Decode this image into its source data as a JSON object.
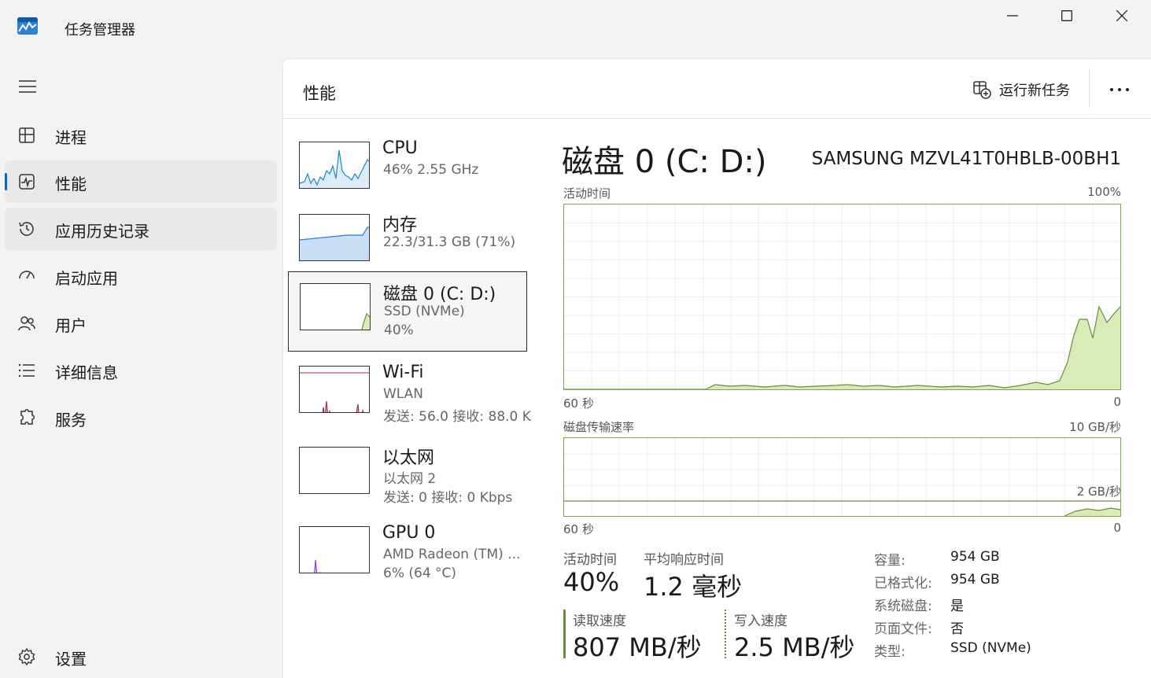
{
  "app": {
    "title": "任务管理器"
  },
  "nav": {
    "items": [
      {
        "label": "进程",
        "icon": "processes-icon"
      },
      {
        "label": "性能",
        "icon": "performance-icon"
      },
      {
        "label": "应用历史记录",
        "icon": "history-icon"
      },
      {
        "label": "启动应用",
        "icon": "startup-icon"
      },
      {
        "label": "用户",
        "icon": "users-icon"
      },
      {
        "label": "详细信息",
        "icon": "details-icon"
      },
      {
        "label": "服务",
        "icon": "services-icon"
      }
    ],
    "settings_label": "设置"
  },
  "header": {
    "title": "性能",
    "run_task_label": "运行新任务",
    "more_label": "···"
  },
  "devices": [
    {
      "name": "CPU",
      "sub1": "46%  2.55 GHz",
      "sub2": ""
    },
    {
      "name": "内存",
      "sub1": "22.3/31.3 GB (71%)",
      "sub2": ""
    },
    {
      "name": "磁盘 0 (C: D:)",
      "sub1": "SSD (NVMe)",
      "sub2": "40%"
    },
    {
      "name": "Wi-Fi",
      "sub1": "WLAN",
      "sub2": "发送: 56.0  接收: 88.0 K"
    },
    {
      "name": "以太网",
      "sub1": "以太网 2",
      "sub2": "发送: 0  接收: 0 Kbps"
    },
    {
      "name": "GPU 0",
      "sub1": "AMD Radeon (TM) ...",
      "sub2": "6%  (64 °C)"
    }
  ],
  "detail": {
    "title": "磁盘 0 (C: D:)",
    "model": "SAMSUNG MZVL41T0HBLB-00BH1",
    "graph1": {
      "label": "活动时间",
      "max": "100%",
      "time": "60 秒",
      "min": "0"
    },
    "graph2": {
      "label": "磁盘传输速率",
      "max": "10 GB/秒",
      "mid": "2 GB/秒",
      "time": "60 秒",
      "min": "0"
    },
    "stats": {
      "active_label": "活动时间",
      "active_value": "40%",
      "resp_label": "平均响应时间",
      "resp_value": "1.2 毫秒",
      "read_label": "读取速度",
      "read_value": "807 MB/秒",
      "write_label": "写入速度",
      "write_value": "2.5 MB/秒"
    },
    "props": [
      {
        "label": "容量:",
        "value": "954 GB"
      },
      {
        "label": "已格式化:",
        "value": "954 GB"
      },
      {
        "label": "系统磁盘:",
        "value": "是"
      },
      {
        "label": "页面文件:",
        "value": "否"
      },
      {
        "label": "类型:",
        "value": "SSD (NVMe)"
      }
    ]
  },
  "colors": {
    "accent": "#0067c0",
    "disk_line": "#6e8b3d",
    "disk_fill": "#d8ecb8",
    "cpu_line": "#1d8ac4",
    "mem_fill": "#c9dff7",
    "wifi_line": "#a7285a",
    "gpu_line": "#8a3fd0"
  }
}
